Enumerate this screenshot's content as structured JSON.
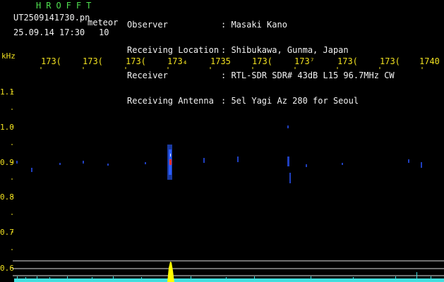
{
  "header": {
    "logo": "HROFFT",
    "filename": "UT2509141730.pn",
    "mode": "meteor",
    "datetime": "25.09.14 17:30",
    "count": "10",
    "labels": [
      "Observer",
      "Receiving Location",
      "Receiver",
      "Receiving Antenna"
    ],
    "values": [
      ": Masaki Kano",
      ": Shibukawa, Gunma, Japan",
      ": RTL-SDR SDR# 43dB L15 96.7MHz CW",
      ": 5el Yagi Az 280 for Seoul"
    ]
  },
  "axis": {
    "unit": "kHz",
    "freq_labels": [
      "173(",
      "173(",
      "173(",
      "173₄",
      "1735",
      "173(",
      "173⁷",
      "173(",
      "173(",
      "1740"
    ],
    "y_labels": [
      "1.1",
      "1.0",
      "0.9",
      "0.8",
      "0.7",
      "0.6"
    ]
  },
  "colors": {
    "background": "#000000",
    "text_green": "#4fe04f",
    "text_white": "#f2f2f2",
    "axis_yellow": "#f0e020",
    "signal_blue": "#2a5cff",
    "signal_red": "#ff3030",
    "spectrum_cyan": "#40e0e0",
    "peak_yellow": "#ffff00"
  }
}
